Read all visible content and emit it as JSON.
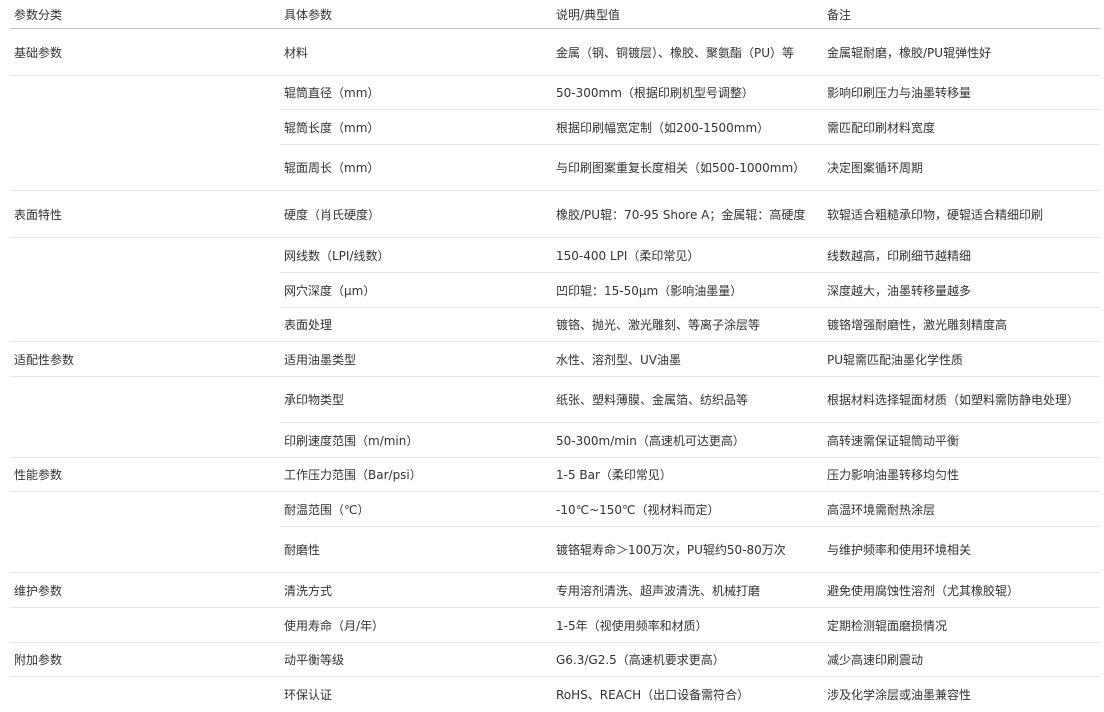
{
  "table": {
    "headers": [
      "参数分类",
      "具体参数",
      "说明/典型值",
      "备注"
    ],
    "rows": [
      {
        "category": "基础参数",
        "param": "材料",
        "desc": "金属（钢、铜镀层）、橡胶、聚氨酯（PU）等",
        "note": "金属辊耐磨，橡胶/PU辊弹性好"
      },
      {
        "category": "",
        "param": "辊筒直径（mm）",
        "desc": "50-300mm（根据印刷机型号调整）",
        "note": "影响印刷压力与油墨转移量"
      },
      {
        "category": "",
        "param": "辊筒长度（mm）",
        "desc": "根据印刷幅宽定制（如200-1500mm）",
        "note": "需匹配印刷材料宽度"
      },
      {
        "category": "",
        "param": "辊面周长（mm）",
        "desc": "与印刷图案重复长度相关（如500-1000mm）",
        "note": "决定图案循环周期"
      },
      {
        "category": "表面特性",
        "param": "硬度（肖氏硬度）",
        "desc": "橡胶/PU辊：70-95 Shore A；金属辊：高硬度",
        "note": "软辊适合粗糙承印物，硬辊适合精细印刷"
      },
      {
        "category": "",
        "param": "网线数（LPI/线数）",
        "desc": "150-400 LPI（柔印常见）",
        "note": "线数越高，印刷细节越精细"
      },
      {
        "category": "",
        "param": "网穴深度（μm）",
        "desc": "凹印辊：15-50μm（影响油墨量）",
        "note": "深度越大，油墨转移量越多"
      },
      {
        "category": "",
        "param": "表面处理",
        "desc": "镀铬、抛光、激光雕刻、等离子涂层等",
        "note": "镀铬增强耐磨性，激光雕刻精度高"
      },
      {
        "category": "适配性参数",
        "param": "适用油墨类型",
        "desc": "水性、溶剂型、UV油墨",
        "note": "PU辊需匹配油墨化学性质"
      },
      {
        "category": "",
        "param": "承印物类型",
        "desc": "纸张、塑料薄膜、金属箔、纺织品等",
        "note": "根据材料选择辊面材质（如塑料需防静电处理）"
      },
      {
        "category": "",
        "param": "印刷速度范围（m/min）",
        "desc": "50-300m/min（高速机可达更高）",
        "note": "高转速需保证辊筒动平衡"
      },
      {
        "category": "性能参数",
        "param": "工作压力范围（Bar/psi）",
        "desc": "1-5 Bar（柔印常见）",
        "note": "压力影响油墨转移均匀性"
      },
      {
        "category": "",
        "param": "耐温范围（℃）",
        "desc": "-10℃~150℃（视材料而定）",
        "note": "高温环境需耐热涂层"
      },
      {
        "category": "",
        "param": "耐磨性",
        "desc": "镀铬辊寿命＞100万次，PU辊约50-80万次",
        "note": "与维护频率和使用环境相关"
      },
      {
        "category": "维护参数",
        "param": "清洗方式",
        "desc": "专用溶剂清洗、超声波清洗、机械打磨",
        "note": "避免使用腐蚀性溶剂（尤其橡胶辊）"
      },
      {
        "category": "",
        "param": "使用寿命（月/年）",
        "desc": "1-5年（视使用频率和材质）",
        "note": "定期检测辊面磨损情况"
      },
      {
        "category": "附加参数",
        "param": "动平衡等级",
        "desc": "G6.3/G2.5（高速机要求更高）",
        "note": "减少高速印刷震动"
      },
      {
        "category": "",
        "param": "环保认证",
        "desc": "RoHS、REACH（出口设备需符合）",
        "note": "涉及化学涂层或油墨兼容性"
      }
    ]
  }
}
